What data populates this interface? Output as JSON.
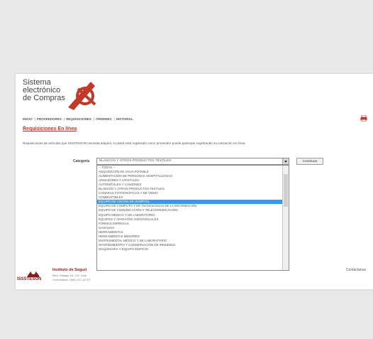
{
  "brand": {
    "line1": "Sistema",
    "line2": "electrónico",
    "line3": "de Compras",
    "logo_icon": "sistema-logo-icon"
  },
  "nav": [
    {
      "label": "INICIO"
    },
    {
      "label": "PROVEEDORES"
    },
    {
      "label": "REQUISICIONES"
    },
    {
      "label": "ÓRDENES"
    },
    {
      "label": "HISTORIAL"
    }
  ],
  "print_icon": "print-icon",
  "page": {
    "subtitle": "Requisiciones En línea",
    "description": "Requisiciones de artículos que ISSSTESON necesita adquirir, si usted está registrado como proveedor puede participar registrando su cotización en línea."
  },
  "form": {
    "category_label": "Categoría",
    "selected_value": "BLANCOS Y OTROS PRODUCTOS TEXTILES",
    "button_label": "Continuar",
    "options": [
      "-- TODAS --",
      "ADQUISICIÓN DE AGUA POTABLE",
      "ALIMENTACIÓN DE PERSONAS HOSPITALIZADAS",
      "ARMAZONES Y CRISTALES",
      "AUTOMÓVILES Y CAMIONES",
      "BLANCOS Y OTROS PRODUCTOS TEXTILES",
      "CÁMARAS FOTOGRÁFICAS Y DE VIDEO",
      "COMBUSTIBLES",
      "EQUIPO DE COCINA DE HOSPITAL",
      "EQUIPO DE CÓMPUTO Y DE TECNOLOGÍAS DE LA INFORMACIÓN",
      "EQUIPO DE COMUNICACIÓN Y TELECOMUNICACIÓN",
      "EQUIPO MÉDICO Y DE LABORATORIO",
      "EQUIPOS Y APARATOS AUDIOVISUALES",
      "FORMAS IMPRESAS",
      "GASOLINA",
      "HERRAMIENTAS",
      "HERRAMIENTAS MENORES",
      "INSTRUMENTAL MÉDICO Y DE LABORATORIO",
      "MANTENIMIENTO Y CONSERVACIÓN DE INMUEBLE",
      "MAQUINARIA Y EQUIPO EDIFICIO"
    ],
    "selected_index": 8
  },
  "footer": {
    "logo_text": "ISSSTESON",
    "title": "Instituto de Seguri",
    "line1": "Blvd. Hidalgo 15, Col. Cent",
    "line2": "Conmutador: (662) 217-19-19",
    "contact": "Contáctanos"
  }
}
